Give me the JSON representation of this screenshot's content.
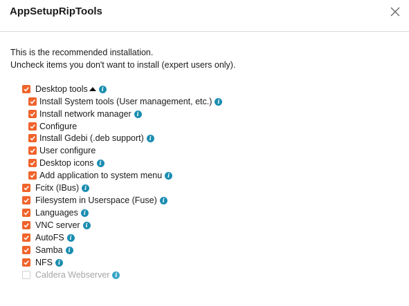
{
  "dialog": {
    "title": "AppSetupRipTools",
    "close_icon": "close-icon"
  },
  "intro": {
    "line1": "This is the recommended installation.",
    "line2": "Uncheck items you don't want to install (expert users only)."
  },
  "colors": {
    "checkbox": "#f0632b",
    "info_icon": "#1a8db0",
    "disabled_text": "#a6a6a6"
  },
  "options": {
    "desktop_tools": {
      "label": "Desktop tools",
      "checked": true,
      "expanded": true
    },
    "system_tools": {
      "label": "Install System tools (User management, etc.)",
      "checked": true
    },
    "network_manager": {
      "label": "Install network manager",
      "checked": true
    },
    "configure": {
      "label": "Configure",
      "checked": true
    },
    "gdebi": {
      "label": "Install Gdebi (.deb support)",
      "checked": true
    },
    "user_configure": {
      "label": "User configure",
      "checked": true
    },
    "desktop_icons": {
      "label": "Desktop icons",
      "checked": true
    },
    "add_to_menu": {
      "label": "Add application to system menu",
      "checked": true
    },
    "fcitx": {
      "label": "Fcitx (IBus)",
      "checked": true
    },
    "fuse": {
      "label": "Filesystem in Userspace (Fuse)",
      "checked": true
    },
    "languages": {
      "label": "Languages",
      "checked": true
    },
    "vnc": {
      "label": "VNC server",
      "checked": true
    },
    "autofs": {
      "label": "AutoFS",
      "checked": true
    },
    "samba": {
      "label": "Samba",
      "checked": true
    },
    "nfs": {
      "label": "NFS",
      "checked": true
    },
    "caldera": {
      "label": "Caldera Webserver",
      "checked": false,
      "disabled": true
    }
  }
}
